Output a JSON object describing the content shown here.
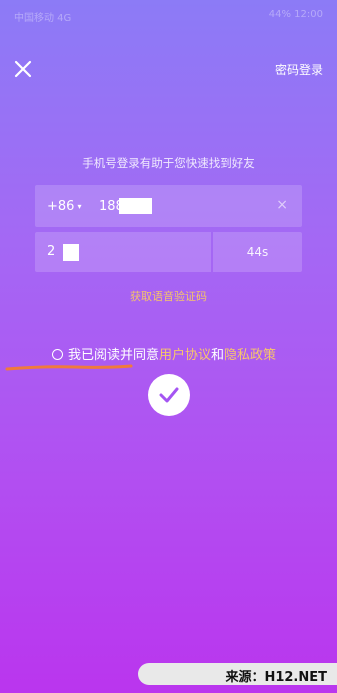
{
  "status_bar": {
    "left": "中国移动 4G",
    "right": "44% 12:00"
  },
  "header": {
    "close_icon": "close-icon",
    "password_login": "密码登录"
  },
  "hint": "手机号登录有助于您快速找到好友",
  "phone": {
    "country_code": "+86",
    "caret": "▾",
    "value": "188",
    "clear_icon": "×"
  },
  "code": {
    "value": "2",
    "countdown": "44s"
  },
  "voice_code": "获取语音验证码",
  "agreement": {
    "prefix": "我已阅读并同意",
    "terms": "用户协议",
    "and": "和",
    "privacy": "隐私政策"
  },
  "submit": {
    "icon": "check-icon"
  },
  "watermark": "来源：H12.NET",
  "colors": {
    "gradient_top": "#8C7BF6",
    "gradient_bottom": "#BA35EE",
    "link": "#F7C66B",
    "annotation": "#F07A3C"
  }
}
